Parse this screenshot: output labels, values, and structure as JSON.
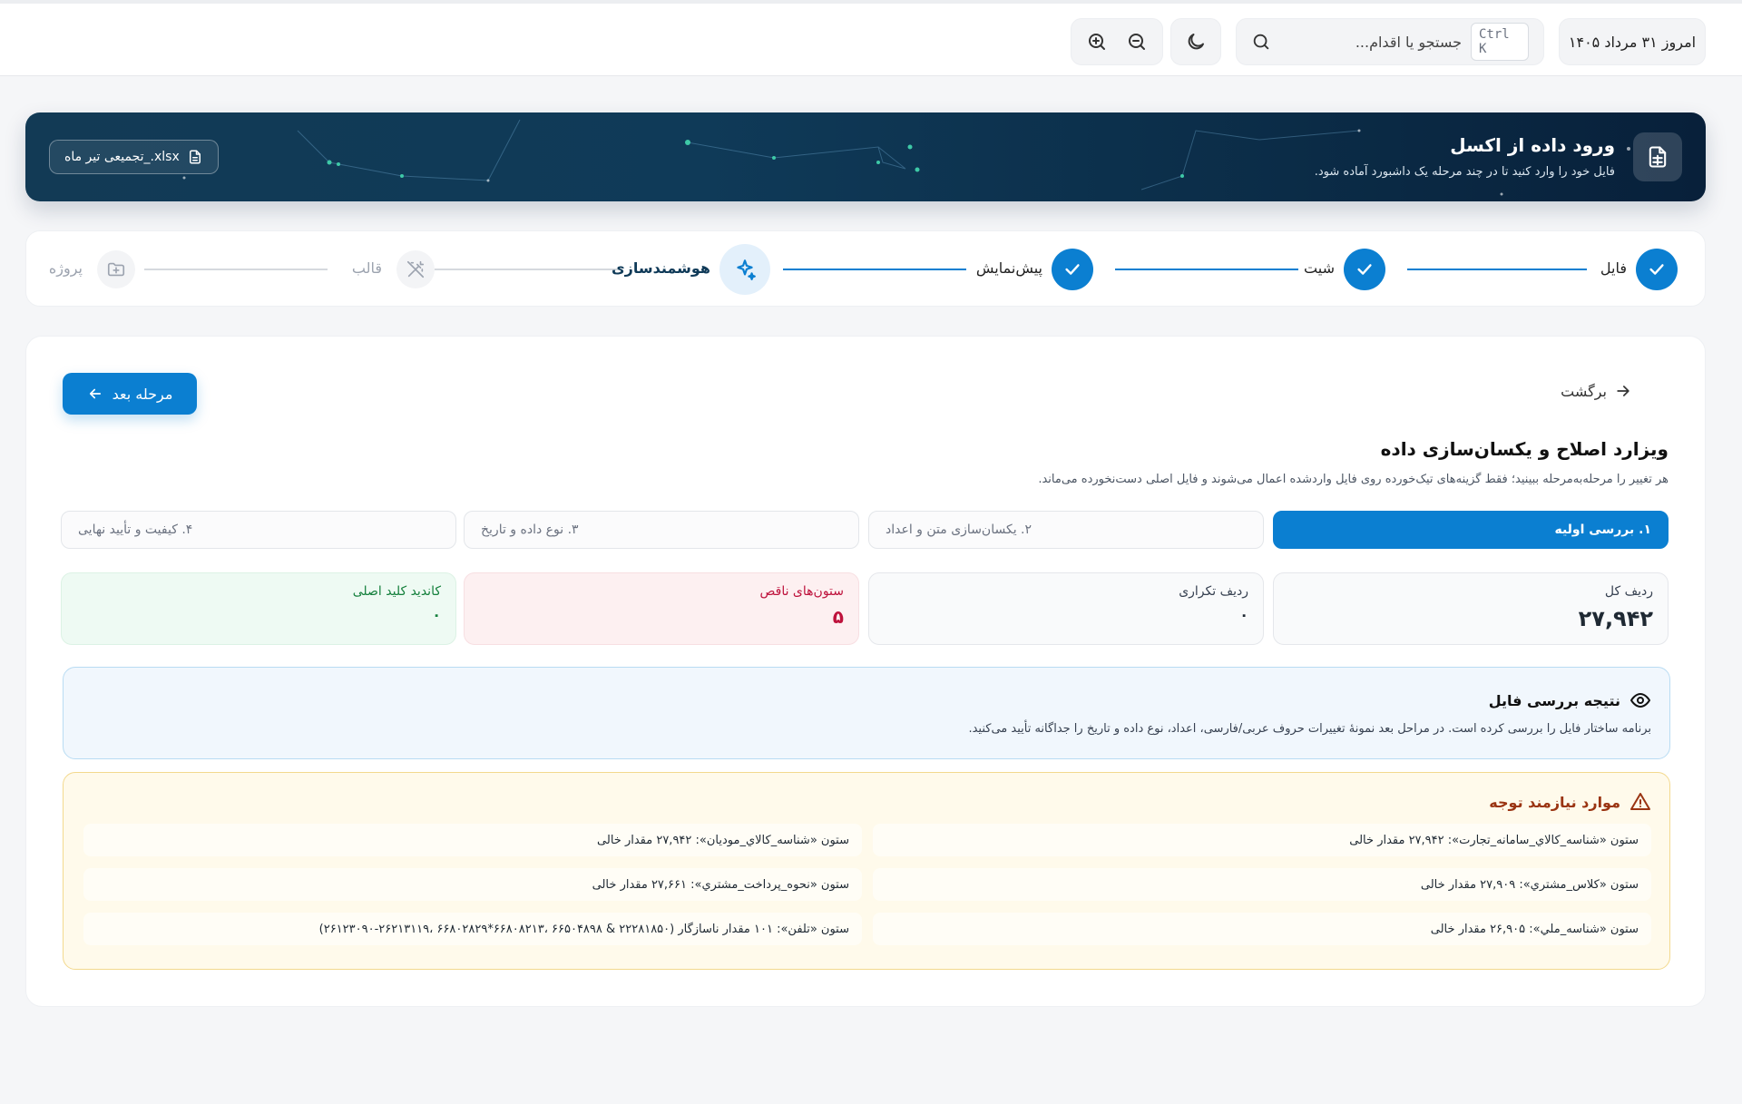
{
  "topbar": {
    "date": "امروز ۳۱ مرداد ۱۴۰۵",
    "search_placeholder": "جستجو یا اقدام...",
    "shortcut": "Ctrl K"
  },
  "banner": {
    "title": "ورود داده از اکسل",
    "subtitle": "فایل خود را وارد کنید تا در چند مرحله یک داشبورد آماده شود.",
    "file_name": "تجمیعی تیر ماه_.xlsx"
  },
  "stepper": {
    "steps": [
      {
        "label": "فایل",
        "state": "done"
      },
      {
        "label": "شیت",
        "state": "done"
      },
      {
        "label": "پیش‌نمایش",
        "state": "done"
      },
      {
        "label": "هوشمندسازی",
        "state": "active"
      },
      {
        "label": "قالب",
        "state": "todo"
      },
      {
        "label": "پروژه",
        "state": "todo"
      }
    ]
  },
  "main": {
    "back_label": "برگشت",
    "next_label": "مرحله بعد",
    "title": "ویزارد اصلاح و یکسان‌سازی داده",
    "subtitle": "هر تغییر را مرحله‌به‌مرحله ببینید؛ فقط گزینه‌های تیک‌خورده روی فایل واردشده اعمال می‌شوند و فایل اصلی دست‌نخورده می‌ماند.",
    "tabs": [
      {
        "label": "۱. بررسی اولیه",
        "active": true
      },
      {
        "label": "۲. یکسان‌سازی متن و اعداد",
        "active": false
      },
      {
        "label": "۳. نوع داده و تاریخ",
        "active": false
      },
      {
        "label": "۴. کیفیت و تأیید نهایی",
        "active": false
      }
    ],
    "stats": [
      {
        "label": "ردیف کل",
        "value": "۲۷,۹۴۲",
        "tone": "neutral"
      },
      {
        "label": "ردیف تکراری",
        "value": "۰",
        "tone": "neutral"
      },
      {
        "label": "ستون‌های ناقص",
        "value": "۵",
        "tone": "red"
      },
      {
        "label": "کاندید کلید اصلی",
        "value": "۰",
        "tone": "green"
      }
    ],
    "result": {
      "title": "نتیجه بررسی فایل",
      "text": "برنامه ساختار فایل را بررسی کرده است. در مراحل بعد نمونهٔ تغییرات حروف عربی/فارسی، اعداد، نوع داده و تاریخ را جداگانه تأیید می‌کنید."
    },
    "warnings": {
      "title": "موارد نیازمند توجه",
      "items": [
        "ستون «شناسه_کالاي_سامانه_تجارت»: ۲۷,۹۴۲ مقدار خالی",
        "ستون «شناسه_کالاي_موديان»: ۲۷,۹۴۲ مقدار خالی",
        "ستون «کلاس_مشتري»: ۲۷,۹۰۹ مقدار خالی",
        "ستون «نحوه_پرداخت_مشتري»: ۲۷,۶۶۱ مقدار خالی",
        "ستون «شناسه_ملي»: ۲۶,۹۰۵ مقدار خالی",
        "ستون «تلفن»: ۱۰۱ مقدار ناسازگار (۲۲۲۸۱۸۵۰ & ۶۶۵۰۴۸۹۸ ،۶۶۸۰۸۲۱۳*۶۶۸۰۲۸۲۹ ،۲۶۲۱۳۱۱۹-۲۶۱۲۳۰۹۰)"
      ]
    }
  },
  "colors": {
    "accent": "#0b7fd1",
    "banner_dark": "#0b2c47",
    "danger": "#be123c",
    "success": "#15803d",
    "warning": "#9a3412"
  }
}
